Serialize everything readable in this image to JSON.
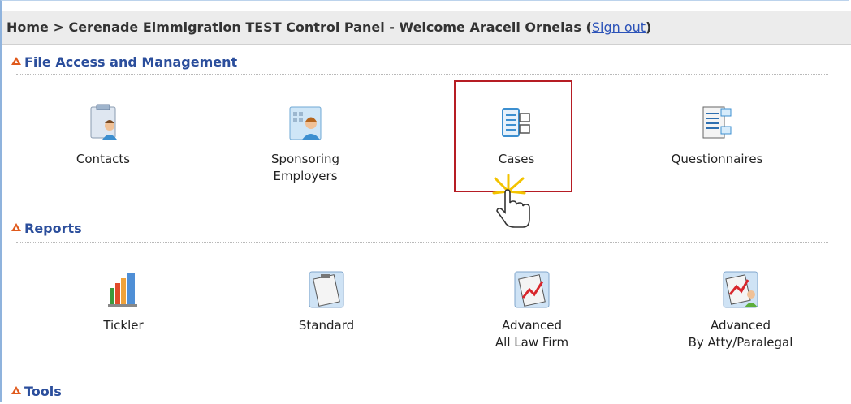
{
  "header": {
    "breadcrumb": "Home > Cerenade Eimmigration TEST Control Panel - Welcome Araceli Ornelas (",
    "sign_out": "Sign out",
    "close_paren": ")"
  },
  "sections": [
    {
      "title": "File Access and Management",
      "items": [
        {
          "label": "Contacts",
          "icon": "contacts-icon"
        },
        {
          "label": "Sponsoring\nEmployers",
          "icon": "sponsoring-employers-icon"
        },
        {
          "label": "Cases",
          "icon": "cases-icon"
        },
        {
          "label": "Questionnaires",
          "icon": "questionnaires-icon"
        }
      ]
    },
    {
      "title": "Reports",
      "items": [
        {
          "label": "Tickler",
          "icon": "bar-chart-icon"
        },
        {
          "label": "Standard",
          "icon": "clipboard-report-icon"
        },
        {
          "label": "Advanced\nAll Law Firm",
          "icon": "clipboard-chart-icon"
        },
        {
          "label": "Advanced\nBy Atty/Paralegal",
          "icon": "clipboard-chart-person-icon"
        }
      ]
    },
    {
      "title": "Tools",
      "items": []
    }
  ],
  "colors": {
    "section_title": "#2b4e9c",
    "highlight_border": "#b61d24",
    "section_marker": "#e05a1c"
  }
}
